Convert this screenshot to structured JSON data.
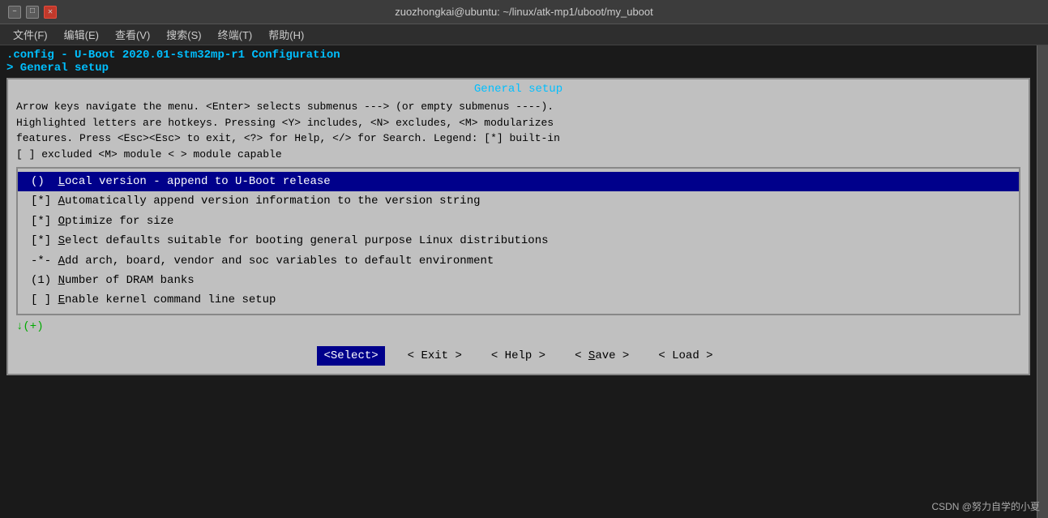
{
  "titlebar": {
    "title": "zuozhongkai@ubuntu: ~/linux/atk-mp1/uboot/my_uboot",
    "min_label": "–",
    "max_label": "□",
    "close_label": "✕"
  },
  "menubar": {
    "items": [
      "文件(F)",
      "编辑(E)",
      "查看(V)",
      "搜索(S)",
      "终端(T)",
      "帮助(H)"
    ]
  },
  "config": {
    "title_line": ".config - U-Boot 2020.01-stm32mp-r1 Configuration",
    "subtitle_line": "> General setup",
    "box_title": "General setup",
    "instructions": [
      "Arrow keys navigate the menu.  <Enter> selects submenus ---> (or empty submenus ----).",
      "Highlighted letters are hotkeys.  Pressing <Y> includes, <N> excludes, <M> modularizes",
      "features.  Press <Esc><Esc> to exit, <?> for Help, </> for Search.  Legend: [*] built-in",
      "[ ] excluded  <M> module  < > module capable"
    ],
    "menu_items": [
      {
        "text": "()  Local version - append to U-Boot release",
        "highlighted": true
      },
      {
        "text": "[*] Automatically append version information to the version string",
        "highlighted": false
      },
      {
        "text": "[*] Optimize for size",
        "highlighted": false
      },
      {
        "text": "[*] Select defaults suitable for booting general purpose Linux distributions",
        "highlighted": false
      },
      {
        "text": "-*- Add arch, board, vendor and soc variables to default environment",
        "highlighted": false
      },
      {
        "text": "(1) Number of DRAM banks",
        "highlighted": false
      },
      {
        "text": "[ ] Enable kernel command line setup",
        "highlighted": false
      }
    ],
    "footer": "↓(+)",
    "buttons": [
      {
        "label": "<Select>",
        "active": true
      },
      {
        "label": "< Exit >",
        "active": false
      },
      {
        "label": "< Help >",
        "active": false
      },
      {
        "label": "< Save >",
        "active": false
      },
      {
        "label": "< Load >",
        "active": false
      }
    ]
  },
  "watermark": "CSDN @努力自学的小夏"
}
